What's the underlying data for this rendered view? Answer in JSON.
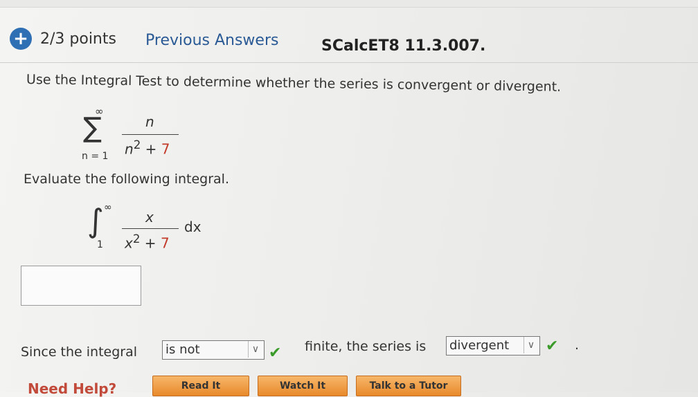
{
  "header": {
    "plus_symbol": "+",
    "points": "2/3 points",
    "previous_answers": "Previous Answers",
    "code": "SCalcET8 11.3.007."
  },
  "question": "Use the Integral Test to determine whether the series is convergent or divergent.",
  "series": {
    "sigma": "∑",
    "upper": "∞",
    "lower": "n = 1",
    "numerator": "n",
    "denominator_base": "n",
    "denominator_exp": "2",
    "denominator_plus": " + ",
    "denominator_const": "7"
  },
  "evaluate": "Evaluate the following integral.",
  "integral": {
    "symbol": "∫",
    "upper": "∞",
    "lower": "1",
    "numerator": "x",
    "denominator_base": "x",
    "denominator_exp": "2",
    "denominator_plus": " + ",
    "denominator_const": "7",
    "dx": "dx"
  },
  "answer": {
    "value": ""
  },
  "conclusion": {
    "since_text": "Since the integral",
    "select1_value": "is not",
    "finite_text": "finite, the series is",
    "select2_value": "divergent",
    "period": "."
  },
  "help": {
    "label": "Need Help?",
    "read_it": "Read It",
    "watch_it": "Watch It",
    "talk_tutor": "Talk to a Tutor"
  },
  "colors": {
    "accent": "#2f6fb3",
    "correct": "#3a9a2a",
    "constant": "#c23a2a"
  }
}
